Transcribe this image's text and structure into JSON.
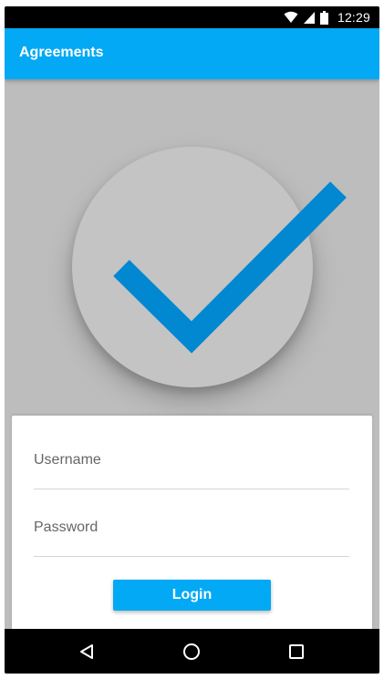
{
  "status_bar": {
    "time": "12:29",
    "icons": [
      "wifi-icon",
      "signal-icon",
      "battery-icon"
    ]
  },
  "app_bar": {
    "title": "Agreements"
  },
  "hero": {
    "icon": "checkmark-icon",
    "check_color": "#0288d1"
  },
  "login_form": {
    "username_placeholder": "Username",
    "username_value": "",
    "password_placeholder": "Password",
    "password_value": "",
    "login_label": "Login"
  },
  "nav_bar": {
    "icons": [
      "back-icon",
      "home-icon",
      "recents-icon"
    ]
  },
  "colors": {
    "primary": "#03a9f4",
    "background": "#bdbdbd",
    "check": "#0288d1"
  }
}
